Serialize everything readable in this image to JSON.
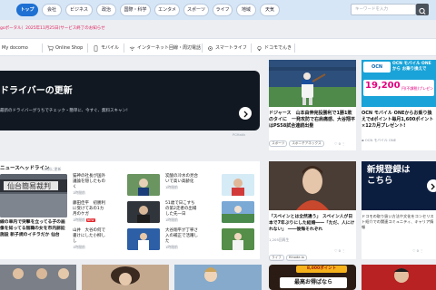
{
  "tabs": [
    {
      "label": "トップ",
      "active": true
    },
    {
      "label": "会社"
    },
    {
      "label": "ビジネス"
    },
    {
      "label": "政治"
    },
    {
      "label": "国際・科学"
    },
    {
      "label": "エンタメ"
    },
    {
      "label": "スポーツ"
    },
    {
      "label": "ライフ"
    },
    {
      "label": "地域"
    },
    {
      "label": "天気"
    }
  ],
  "search": {
    "placeholder": "キーワードを入力"
  },
  "notice": "goポータル）2025年11月25日(サービス終了のお知らせ",
  "nav": [
    {
      "label": "My docomo",
      "icon": "person-icon"
    },
    {
      "label": "Online Shop",
      "icon": "cart-icon"
    },
    {
      "label": "モバイル",
      "icon": "phone-icon"
    },
    {
      "label": "インターネット回線・周辺電話",
      "icon": "wifi-icon"
    },
    {
      "label": "スマートライフ",
      "icon": "gear-icon"
    },
    {
      "label": "ドコモでんき",
      "icon": "bulb-icon"
    }
  ],
  "hero": {
    "title": "ドライバーの更新",
    "subtitle": "最新のドライバーがうちでチェック・簡単に、今すぐ、無料スキャン!",
    "credit": "PCMatik"
  },
  "mid_cards": [
    {
      "headline": "ドジャース　山本由伸完投勝利で1勝1敗のタイに　一発攻防で右肩痛感、大谷翔平はPS58試合連続出塁",
      "tags": [
        "スポーツ",
        "スポニチアネックス"
      ],
      "likes": "0"
    },
    {
      "ad_title": "OCN モバイル ONE から お乗り換えで",
      "ad_amount": "19,200",
      "ad_suffix": "円(不課税)プレゼント!",
      "headline": "OCN モバイル ONEからお乗り換えでdポイント毎月1,600ポイント×12カ月プレゼント!",
      "source": "OCN モバイル ONE"
    }
  ],
  "news": {
    "title": "ニュースヘッドライン",
    "updated": "1分前に更新",
    "main_caption": "線の車内で突撃を立ってる子の画像を知ってる無職の女を市内訴訟施設 新子規のイチラだか 仙台",
    "items": [
      {
        "text": "猫神の社長が国外議論を隠したものく",
        "meta": "1時間前"
      },
      {
        "text": "炭酸の冷水の見合いで高い高齢化",
        "meta": "1時間前"
      },
      {
        "text": "藤田佳平　初勝利に受けてあの1カ月のケガ",
        "meta": "1時間前",
        "badge": "NEW"
      },
      {
        "text": "51歳で日こすちの第2走者の出場した先一日",
        "meta": "1時間前"
      },
      {
        "text": "山井　大谷の何で書けにした小柳しし",
        "meta": "1時間前"
      },
      {
        "text": "大谷翔平が丁寧さ入の補正で活躍した",
        "meta": "1時間前"
      }
    ]
  },
  "video_card": {
    "headline": "「スペインとは全然違う」 スペイン人が日本で7年ぶりにした結婚――「ただ、人にけれない」 ――後悔それぞれ",
    "meta": "1,205回再生",
    "tags": [
      "ライフ",
      "Hinode.io"
    ],
    "likes": "0"
  },
  "signup_card": {
    "title": "新規登録は\nこちら",
    "body": "ドコモの取り扱い方法や文化をコンセリスト紹介での関連コミュニティ、キャリア情報",
    "likes": "0"
  },
  "bottom_banner": {
    "text": "最高お得ぱなら",
    "amount": "8,000ポイント"
  }
}
